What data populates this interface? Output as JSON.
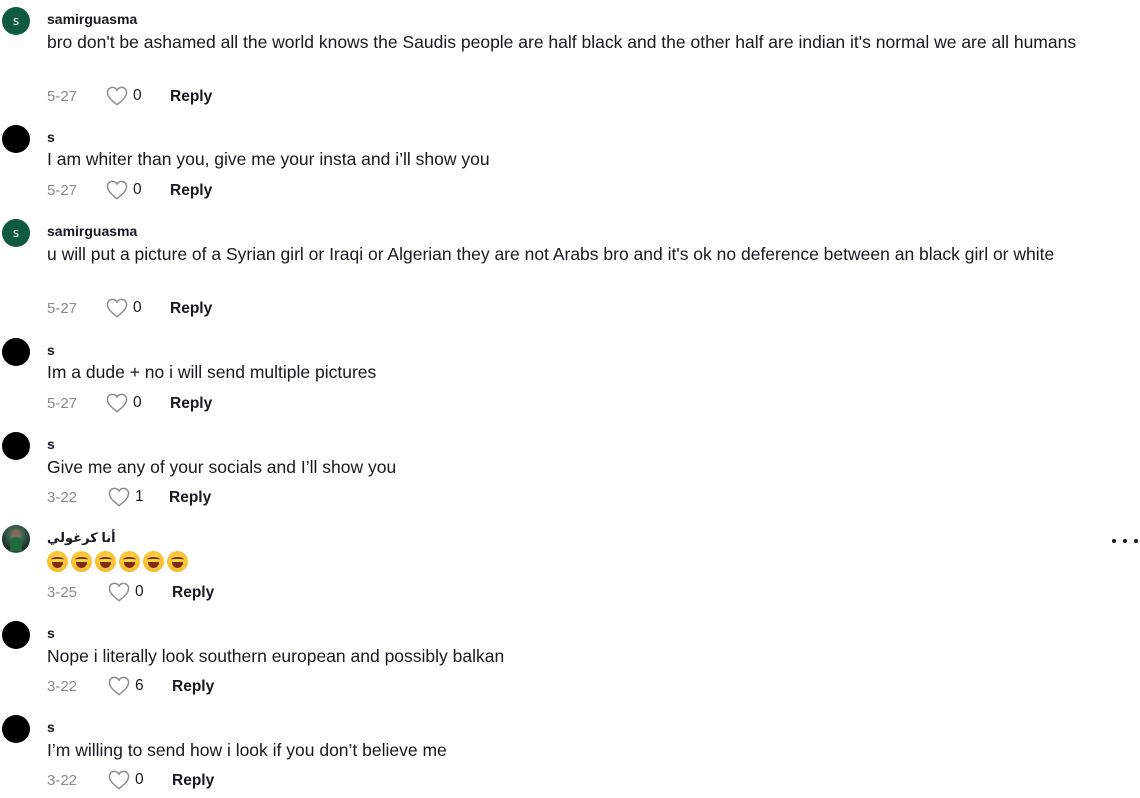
{
  "comments": [
    {
      "username": "samirguasma",
      "avatar_letter": "s",
      "avatar_style": "green",
      "text": "bro don't be ashamed all the world knows the Saudis people are half black and the other half are indian it's normal we are all humans",
      "date": "5-27",
      "likes": "0",
      "reply_label": "Reply"
    },
    {
      "username": "s",
      "avatar_letter": "",
      "avatar_style": "black",
      "text": "I am whiter than you, give me your insta and i’ll show you",
      "date": "5-27",
      "likes": "0",
      "reply_label": "Reply"
    },
    {
      "username": "samirguasma",
      "avatar_letter": "s",
      "avatar_style": "green",
      "text": "u will put a picture of a Syrian girl or Iraqi or Algerian they are not Arabs bro and it's ok no deference between an black girl or white",
      "date": "5-27",
      "likes": "0",
      "reply_label": "Reply"
    },
    {
      "username": "s",
      "avatar_letter": "",
      "avatar_style": "black",
      "text": "Im a dude + no i will send multiple pictures",
      "date": "5-27",
      "likes": "0",
      "reply_label": "Reply"
    },
    {
      "username": "s",
      "avatar_letter": "",
      "avatar_style": "black",
      "text": "Give me any of your socials and I’ll show you",
      "date": "3-22",
      "likes": "1",
      "reply_label": "Reply"
    },
    {
      "username": "أنا كرغولي",
      "avatar_letter": "",
      "avatar_style": "photo",
      "text": "",
      "emoji_count": 6,
      "emoji_name": "rolling-on-floor-laughing",
      "date": "3-25",
      "likes": "0",
      "reply_label": "Reply"
    },
    {
      "username": "s",
      "avatar_letter": "",
      "avatar_style": "black",
      "text": "Nope i literally look southern european and possibly balkan",
      "date": "3-22",
      "likes": "6",
      "reply_label": "Reply"
    },
    {
      "username": "s",
      "avatar_letter": "",
      "avatar_style": "black",
      "text": "I’m willing to send how i look if you don’t believe me",
      "date": "3-22",
      "likes": "0",
      "reply_label": "Reply"
    }
  ],
  "icons": {
    "like": "heart-outline-icon",
    "more": "more-horizontal-icon"
  }
}
